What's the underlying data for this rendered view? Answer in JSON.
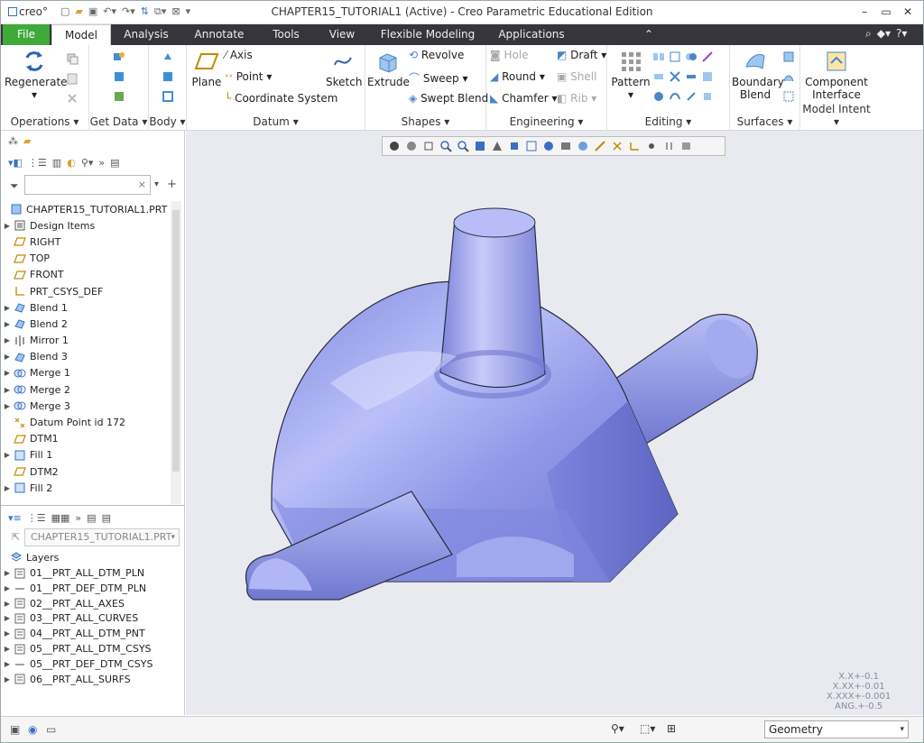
{
  "app": {
    "logo": "creo°",
    "title": "CHAPTER15_TUTORIAL1 (Active) - Creo Parametric Educational Edition"
  },
  "tabs": [
    "File",
    "Model",
    "Analysis",
    "Annotate",
    "Tools",
    "View",
    "Flexible Modeling",
    "Applications"
  ],
  "ribbon": {
    "operations": {
      "regenerate": "Regenerate",
      "label": "Operations"
    },
    "get_data": {
      "label": "Get Data"
    },
    "body": {
      "label": "Body"
    },
    "datum": {
      "plane": "Plane",
      "axis": "Axis",
      "point": "Point",
      "csys": "Coordinate System",
      "sketch": "Sketch",
      "label": "Datum"
    },
    "shapes": {
      "extrude": "Extrude",
      "revolve": "Revolve",
      "sweep": "Sweep",
      "swept_blend": "Swept Blend",
      "label": "Shapes"
    },
    "engineering": {
      "hole": "Hole",
      "draft": "Draft",
      "round": "Round",
      "shell": "Shell",
      "chamfer": "Chamfer",
      "rib": "Rib",
      "label": "Engineering"
    },
    "editing": {
      "pattern": "Pattern",
      "label": "Editing"
    },
    "surfaces": {
      "boundary_blend_1": "Boundary",
      "boundary_blend_2": "Blend",
      "label": "Surfaces"
    },
    "model_intent": {
      "component_interface_1": "Component",
      "component_interface_2": "Interface",
      "label": "Model Intent"
    }
  },
  "model_tree": {
    "items": [
      {
        "label": "CHAPTER15_TUTORIAL1.PRT",
        "icon": "part-icon",
        "expand": false,
        "indent": 0
      },
      {
        "label": "Design Items",
        "icon": "design-items-icon",
        "expand": true,
        "indent": 1
      },
      {
        "label": "RIGHT",
        "icon": "datum-plane-icon",
        "expand": false,
        "indent": 1
      },
      {
        "label": "TOP",
        "icon": "datum-plane-icon",
        "expand": false,
        "indent": 1
      },
      {
        "label": "FRONT",
        "icon": "datum-plane-icon",
        "expand": false,
        "indent": 1
      },
      {
        "label": "PRT_CSYS_DEF",
        "icon": "csys-icon",
        "expand": false,
        "indent": 1
      },
      {
        "label": "Blend 1",
        "icon": "blend-icon",
        "expand": true,
        "indent": 1
      },
      {
        "label": "Blend 2",
        "icon": "blend-icon",
        "expand": true,
        "indent": 1
      },
      {
        "label": "Mirror 1",
        "icon": "mirror-icon",
        "expand": true,
        "indent": 1
      },
      {
        "label": "Blend 3",
        "icon": "blend-icon",
        "expand": true,
        "indent": 1
      },
      {
        "label": "Merge 1",
        "icon": "merge-icon",
        "expand": true,
        "indent": 1
      },
      {
        "label": "Merge 2",
        "icon": "merge-icon",
        "expand": true,
        "indent": 1
      },
      {
        "label": "Merge 3",
        "icon": "merge-icon",
        "expand": true,
        "indent": 1
      },
      {
        "label": "Datum Point id 172",
        "icon": "datum-point-icon",
        "expand": false,
        "indent": 1
      },
      {
        "label": "DTM1",
        "icon": "datum-plane-icon",
        "expand": false,
        "indent": 1
      },
      {
        "label": "Fill 1",
        "icon": "fill-icon",
        "expand": true,
        "indent": 1
      },
      {
        "label": "DTM2",
        "icon": "datum-plane-icon",
        "expand": false,
        "indent": 1
      },
      {
        "label": "Fill 2",
        "icon": "fill-icon",
        "expand": true,
        "indent": 1
      }
    ]
  },
  "layer_tree": {
    "model_select": "CHAPTER15_TUTORIAL1.PRT",
    "header": "Layers",
    "items": [
      {
        "label": "01__PRT_ALL_DTM_PLN"
      },
      {
        "label": "01__PRT_DEF_DTM_PLN"
      },
      {
        "label": "02__PRT_ALL_AXES"
      },
      {
        "label": "03__PRT_ALL_CURVES"
      },
      {
        "label": "04__PRT_ALL_DTM_PNT"
      },
      {
        "label": "05__PRT_ALL_DTM_CSYS"
      },
      {
        "label": "05__PRT_DEF_DTM_CSYS"
      },
      {
        "label": "06__PRT_ALL_SURFS"
      }
    ]
  },
  "tolerances": [
    "X.X+-0.1",
    "X.XX+-0.01",
    "X.XXX+-0.001",
    "ANG.+-0.5"
  ],
  "status": {
    "filter": "Geometry"
  },
  "colors": {
    "model": "#8f98e8",
    "file_tab": "#3fa93a",
    "tab_bar": "#35353b"
  }
}
